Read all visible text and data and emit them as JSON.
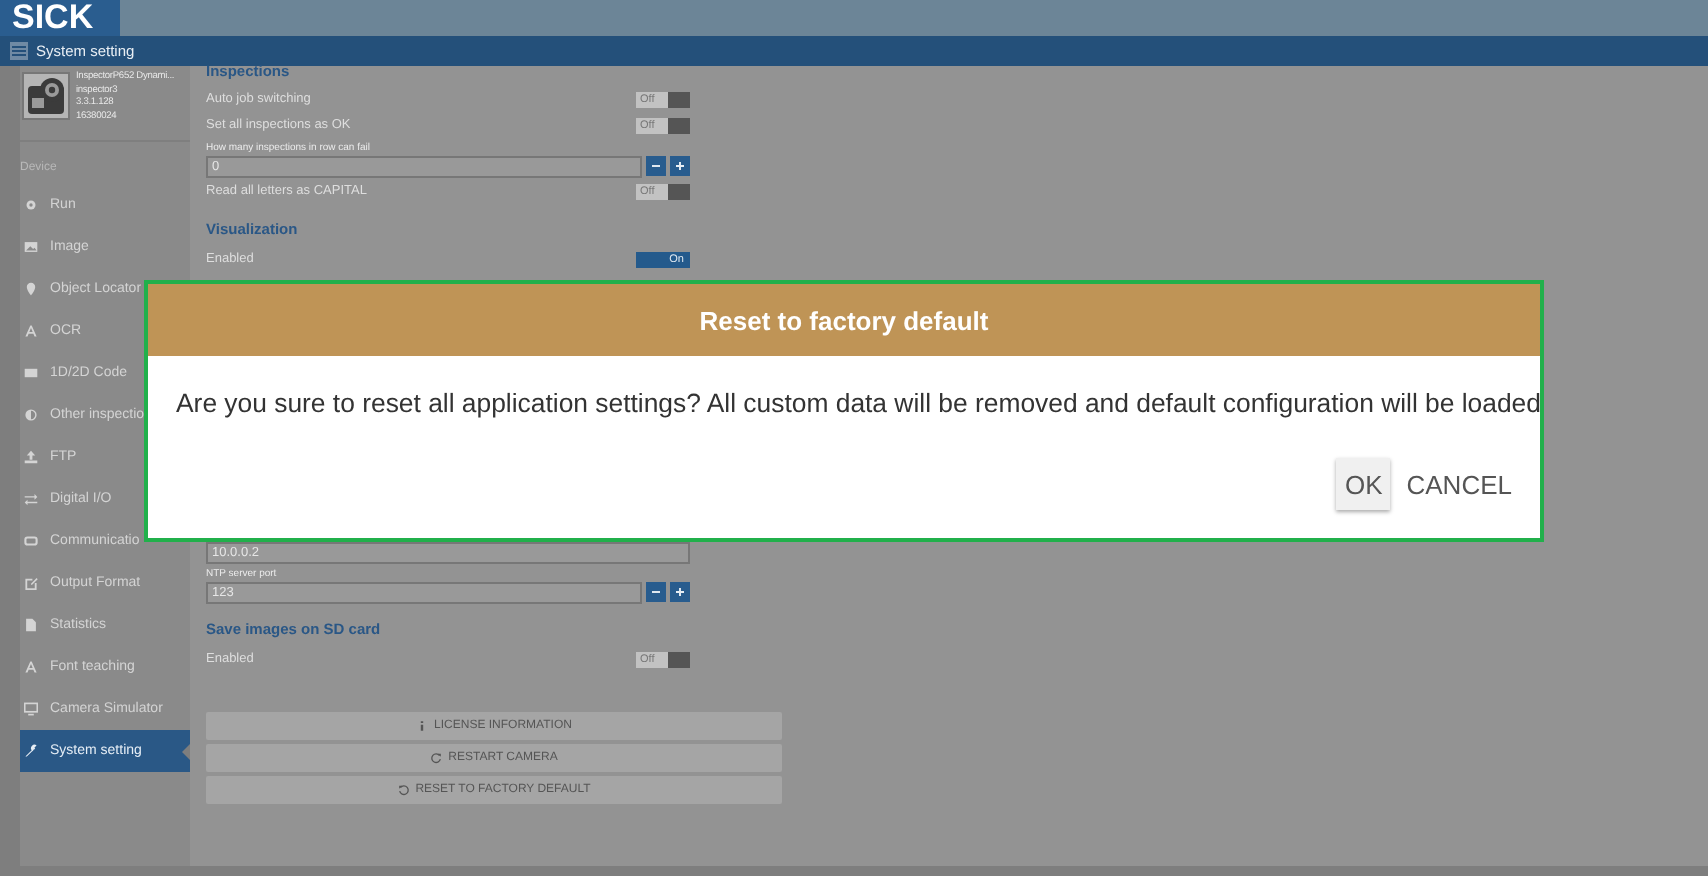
{
  "header": {
    "logo": "SICK",
    "page_title": "System setting"
  },
  "device": {
    "name": "InspectorP652 Dynami...",
    "type": "inspector3",
    "version": "3.3.1.128",
    "serial": "16380024"
  },
  "sidebar": {
    "section": "Device",
    "items": [
      {
        "label": "Run",
        "selected": false
      },
      {
        "label": "Image",
        "selected": false
      },
      {
        "label": "Object Locator",
        "selected": false
      },
      {
        "label": "OCR",
        "selected": false
      },
      {
        "label": "1D/2D Code",
        "selected": false
      },
      {
        "label": "Other inspectio",
        "selected": false
      },
      {
        "label": "FTP",
        "selected": false
      },
      {
        "label": "Digital I/O",
        "selected": false
      },
      {
        "label": "Communicatio",
        "selected": false
      },
      {
        "label": "Output Format",
        "selected": false
      },
      {
        "label": "Statistics",
        "selected": false
      },
      {
        "label": "Font teaching",
        "selected": false
      },
      {
        "label": "Camera Simulator",
        "selected": false
      },
      {
        "label": "System setting",
        "selected": true
      }
    ]
  },
  "settings_top": [
    {
      "kind": "heading",
      "label": "Inspections"
    },
    {
      "kind": "toggle",
      "label": "Auto job switching",
      "on": false,
      "state": "Off"
    },
    {
      "kind": "toggle",
      "label": "Set all inspections as OK",
      "on": false,
      "state": "Off"
    },
    {
      "kind": "number",
      "label": "How many inspections in row can fail",
      "value": "0"
    },
    {
      "kind": "toggle",
      "label": "Read all letters as CAPITAL",
      "on": false,
      "state": "Off"
    },
    {
      "kind": "heading",
      "label": "Visualization"
    },
    {
      "kind": "toggle",
      "label": "Enabled",
      "on": true,
      "state": "On"
    }
  ],
  "settings_bottom": [
    {
      "kind": "text",
      "value": "10.0.0.2"
    },
    {
      "kind": "number",
      "label": "NTP server port",
      "value": "123"
    },
    {
      "kind": "heading",
      "label": "Save images on SD card"
    },
    {
      "kind": "toggle",
      "label": "Enabled",
      "on": false,
      "state": "Off"
    }
  ],
  "actions": [
    {
      "label": "LICENSE INFORMATION"
    },
    {
      "label": "RESTART CAMERA"
    },
    {
      "label": "RESET TO FACTORY DEFAULT"
    }
  ],
  "dialog": {
    "title": "Reset to factory default",
    "message": "Are you sure to reset all application settings? All custom data will be removed and default configuration will be loaded",
    "buttons": [
      {
        "label": "OK",
        "kind": "raised"
      },
      {
        "label": "CANCEL",
        "kind": "flat"
      }
    ]
  }
}
